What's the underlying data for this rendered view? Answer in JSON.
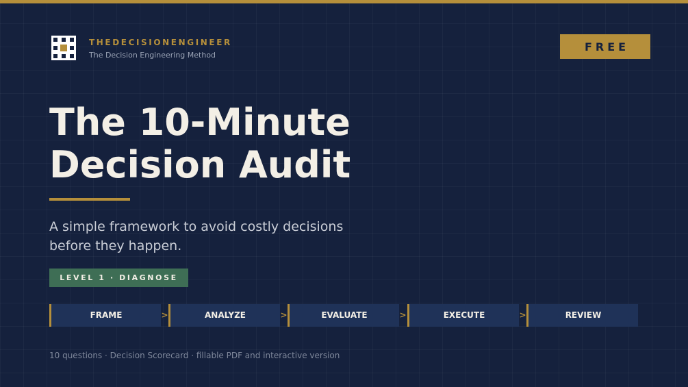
{
  "colors": {
    "background": "#15213d",
    "accent": "#b58f3b",
    "level_green": "#3e6e55",
    "step_background": "#1f3258"
  },
  "brand": {
    "name": "THEDECISIONENGINEER",
    "tagline": "The Decision Engineering Method",
    "logo_icon": "grid-logo-icon"
  },
  "badge": {
    "label": "FREE"
  },
  "hero": {
    "title_line1": "The 10-Minute",
    "title_line2": "Decision Audit",
    "subtitle_line1": "A simple framework to avoid costly decisions",
    "subtitle_line2": "before they happen."
  },
  "level": {
    "label": "LEVEL 1 · DIAGNOSE"
  },
  "steps": [
    {
      "label": "FRAME"
    },
    {
      "label": "ANALYZE"
    },
    {
      "label": "EVALUATE"
    },
    {
      "label": "EXECUTE"
    },
    {
      "label": "REVIEW"
    }
  ],
  "step_separator": ">",
  "footnote": "10 questions · Decision Scorecard · fillable PDF and interactive version"
}
